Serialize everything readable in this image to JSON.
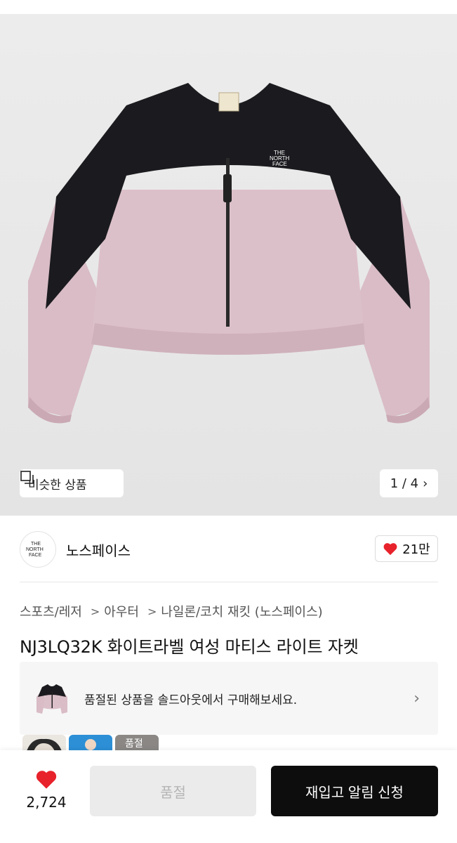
{
  "gallery": {
    "similar_label": "비슷한 상품",
    "page_indicator": "1 / 4"
  },
  "brand": {
    "name": "노스페이스",
    "logo_text": "THE NORTH FACE",
    "like_count": "21만"
  },
  "breadcrumb": {
    "items": [
      "스포츠/레저",
      "아우터",
      "나일론/코치 재킷 (노스페이스)"
    ]
  },
  "product": {
    "title": "NJ3LQ32K 화이트라벨 여성 마티스 라이트 자켓"
  },
  "soldout_banner": {
    "text": "품절된 상품을 솔드아웃에서 구매해보세요."
  },
  "thumbnails": {
    "overlay_label": "품절"
  },
  "bottom_bar": {
    "wish_count": "2,724",
    "soldout_label": "품절",
    "restock_label": "재입고 알림 신청"
  },
  "colors": {
    "jacket_pink": "#dcc0c9",
    "jacket_black": "#1b1b1f",
    "heart_red": "#e8222b",
    "cta_black": "#0d0d0d"
  }
}
